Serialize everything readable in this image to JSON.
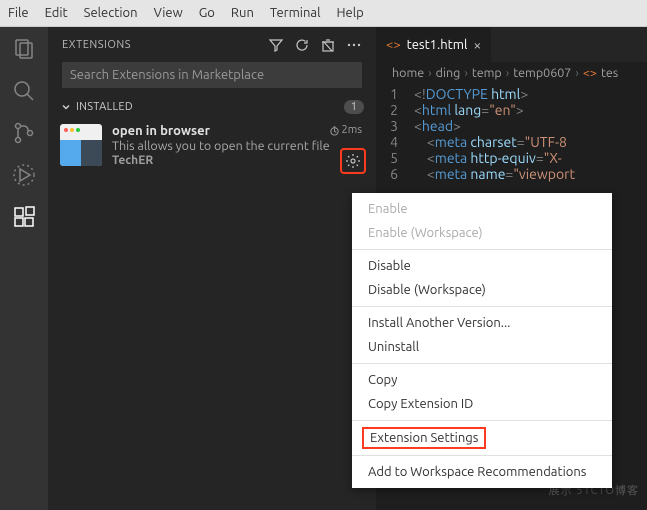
{
  "menubar": [
    "File",
    "Edit",
    "Selection",
    "View",
    "Go",
    "Run",
    "Terminal",
    "Help"
  ],
  "sidebar": {
    "title": "EXTENSIONS",
    "search_placeholder": "Search Extensions in Marketplace",
    "section_label": "INSTALLED",
    "section_count": "1",
    "ext": {
      "name": "open in browser",
      "desc": "This allows you to open the current file",
      "publisher": "TechER",
      "time": "2ms"
    }
  },
  "editor": {
    "tab_name": "test1.html",
    "breadcrumb": [
      "home",
      "ding",
      "temp",
      "temp0607",
      "tes"
    ]
  },
  "code_lines": [
    {
      "n": "1",
      "frags": [
        {
          "c": "t-punc",
          "t": "<!"
        },
        {
          "c": "t-doctype",
          "t": "DOCTYPE "
        },
        {
          "c": "t-attr",
          "t": "html"
        },
        {
          "c": "t-punc",
          "t": ">"
        }
      ]
    },
    {
      "n": "2",
      "frags": [
        {
          "c": "t-punc",
          "t": "<"
        },
        {
          "c": "t-tag",
          "t": "html "
        },
        {
          "c": "t-attr",
          "t": "lang"
        },
        {
          "c": "t-punc",
          "t": "="
        },
        {
          "c": "t-str",
          "t": "\"en\""
        },
        {
          "c": "t-punc",
          "t": ">"
        }
      ]
    },
    {
      "n": "3",
      "frags": [
        {
          "c": "t-punc",
          "t": "<"
        },
        {
          "c": "t-tag",
          "t": "head"
        },
        {
          "c": "t-punc",
          "t": ">"
        }
      ]
    },
    {
      "n": "4",
      "frags": [
        {
          "c": "",
          "t": "    "
        },
        {
          "c": "t-punc",
          "t": "<"
        },
        {
          "c": "t-tag",
          "t": "meta "
        },
        {
          "c": "t-attr",
          "t": "charset"
        },
        {
          "c": "t-punc",
          "t": "="
        },
        {
          "c": "t-str",
          "t": "\"UTF-8"
        }
      ]
    },
    {
      "n": "5",
      "frags": [
        {
          "c": "",
          "t": "    "
        },
        {
          "c": "t-punc",
          "t": "<"
        },
        {
          "c": "t-tag",
          "t": "meta "
        },
        {
          "c": "t-attr",
          "t": "http-equiv"
        },
        {
          "c": "t-punc",
          "t": "="
        },
        {
          "c": "t-str",
          "t": "\"X-"
        }
      ]
    },
    {
      "n": "6",
      "frags": [
        {
          "c": "",
          "t": "    "
        },
        {
          "c": "t-punc",
          "t": "<"
        },
        {
          "c": "t-tag",
          "t": "meta "
        },
        {
          "c": "t-attr",
          "t": "name"
        },
        {
          "c": "t-punc",
          "t": "="
        },
        {
          "c": "t-str",
          "t": "\"viewport"
        }
      ]
    }
  ],
  "context_menu": {
    "groups": [
      [
        {
          "label": "Enable",
          "disabled": true
        },
        {
          "label": "Enable (Workspace)",
          "disabled": true
        }
      ],
      [
        {
          "label": "Disable"
        },
        {
          "label": "Disable (Workspace)"
        }
      ],
      [
        {
          "label": "Install Another Version..."
        },
        {
          "label": "Uninstall"
        }
      ],
      [
        {
          "label": "Copy"
        },
        {
          "label": "Copy Extension ID"
        }
      ],
      [
        {
          "label": "Extension Settings",
          "highlight": true
        }
      ],
      [
        {
          "label": "Add to Workspace Recommendations"
        }
      ]
    ]
  }
}
